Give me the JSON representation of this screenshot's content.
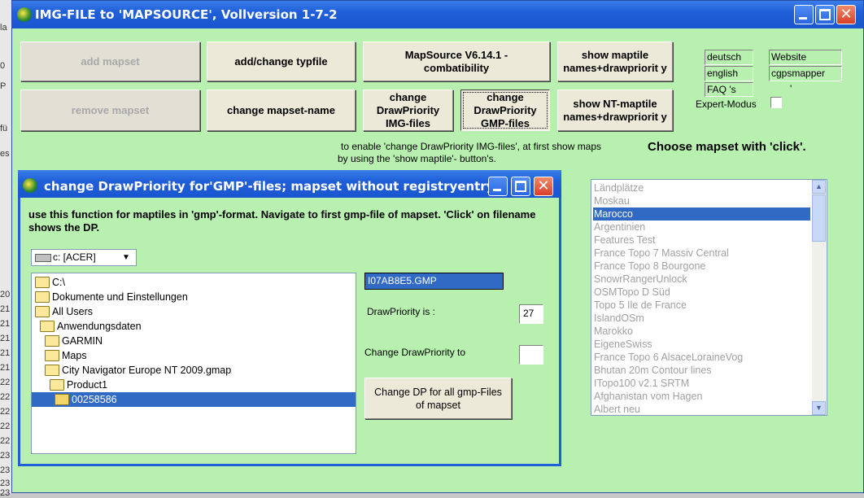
{
  "background_window": {
    "fragments": [
      "la",
      "0",
      "P",
      "fü",
      "es",
      "20",
      "21",
      "21",
      "21",
      "21",
      "21",
      "22",
      "22",
      "22",
      "22",
      "22",
      "23",
      "23",
      "23",
      "23"
    ]
  },
  "main_window": {
    "title": "IMG-FILE to 'MAPSOURCE', Vollversion 1-7-2",
    "buttons": {
      "add_mapset": "add mapset",
      "remove_mapset": "remove mapset",
      "add_change_typfile": "add/change typfile",
      "change_mapset_name": "change mapset-name",
      "mapsource_compat": "MapSource V6.14.1 -combatibility",
      "change_dp_img": "change DrawPriority IMG-files",
      "change_dp_gmp": "change DrawPriority GMP-files",
      "show_maptile_names": "show maptile names+drawpriorit y",
      "show_nt_maptile_names": "show NT-maptile names+drawpriorit y"
    },
    "links": {
      "deutsch": "deutsch",
      "english": "english",
      "faq": "FAQ 's",
      "website": "Website",
      "cgpsmapper": "cgpsmapper"
    },
    "expert_mode_label": "Expert-Modus",
    "apostrophe": "'",
    "hint_line1": "to enable 'change DrawPriority IMG-files', at first show maps",
    "hint_line2": "by using the 'show maptile'- button's.",
    "choose_heading": "Choose mapset with 'click'.",
    "mapset_list": {
      "items": [
        "Ländplätze",
        "Moskau",
        "Marocco",
        "Argentinien",
        "Features Test",
        "France Topo 7 Massiv Central",
        "France Topo 8 Bourgone",
        "SnowrRangerUnlock",
        "OSMTopo D Süd",
        "Topo 5 Ile de France",
        "IslandOSm",
        "Marokko",
        "EigeneSwiss",
        "France Topo 6 AlsaceLoraineVog",
        "Bhutan 20m Contour lines",
        "ITopo100 v2.1 SRTM",
        "Afghanistan vom Hagen",
        "Albert neu"
      ],
      "selected": "Marocco"
    }
  },
  "dialog": {
    "title": "change DrawPriority for'GMP'-files; mapset without registryentry",
    "description": "use this function for maptiles in 'gmp'-format. Navigate to first gmp-file of mapset. 'Click' on filename shows the DP.",
    "drive": "c: [ACER]",
    "tree": [
      {
        "label": "C:\\",
        "level": 0
      },
      {
        "label": "Dokumente und Einstellungen",
        "level": 0
      },
      {
        "label": "All Users",
        "level": 0
      },
      {
        "label": "Anwendungsdaten",
        "level": 1
      },
      {
        "label": "GARMIN",
        "level": 2
      },
      {
        "label": "Maps",
        "level": 2
      },
      {
        "label": "City Navigator Europe NT 2009.gmap",
        "level": 2
      },
      {
        "label": "Product1",
        "level": 3
      },
      {
        "label": "00258586",
        "level": 4,
        "selected": true
      }
    ],
    "file_value": "I07AB8E5.GMP",
    "dp_is_label": "DrawPriority is :",
    "dp_value": "27",
    "change_dp_label": "Change DrawPriority to",
    "change_dp_value": "",
    "change_all_button": "Change DP for all gmp-Files of mapset"
  }
}
